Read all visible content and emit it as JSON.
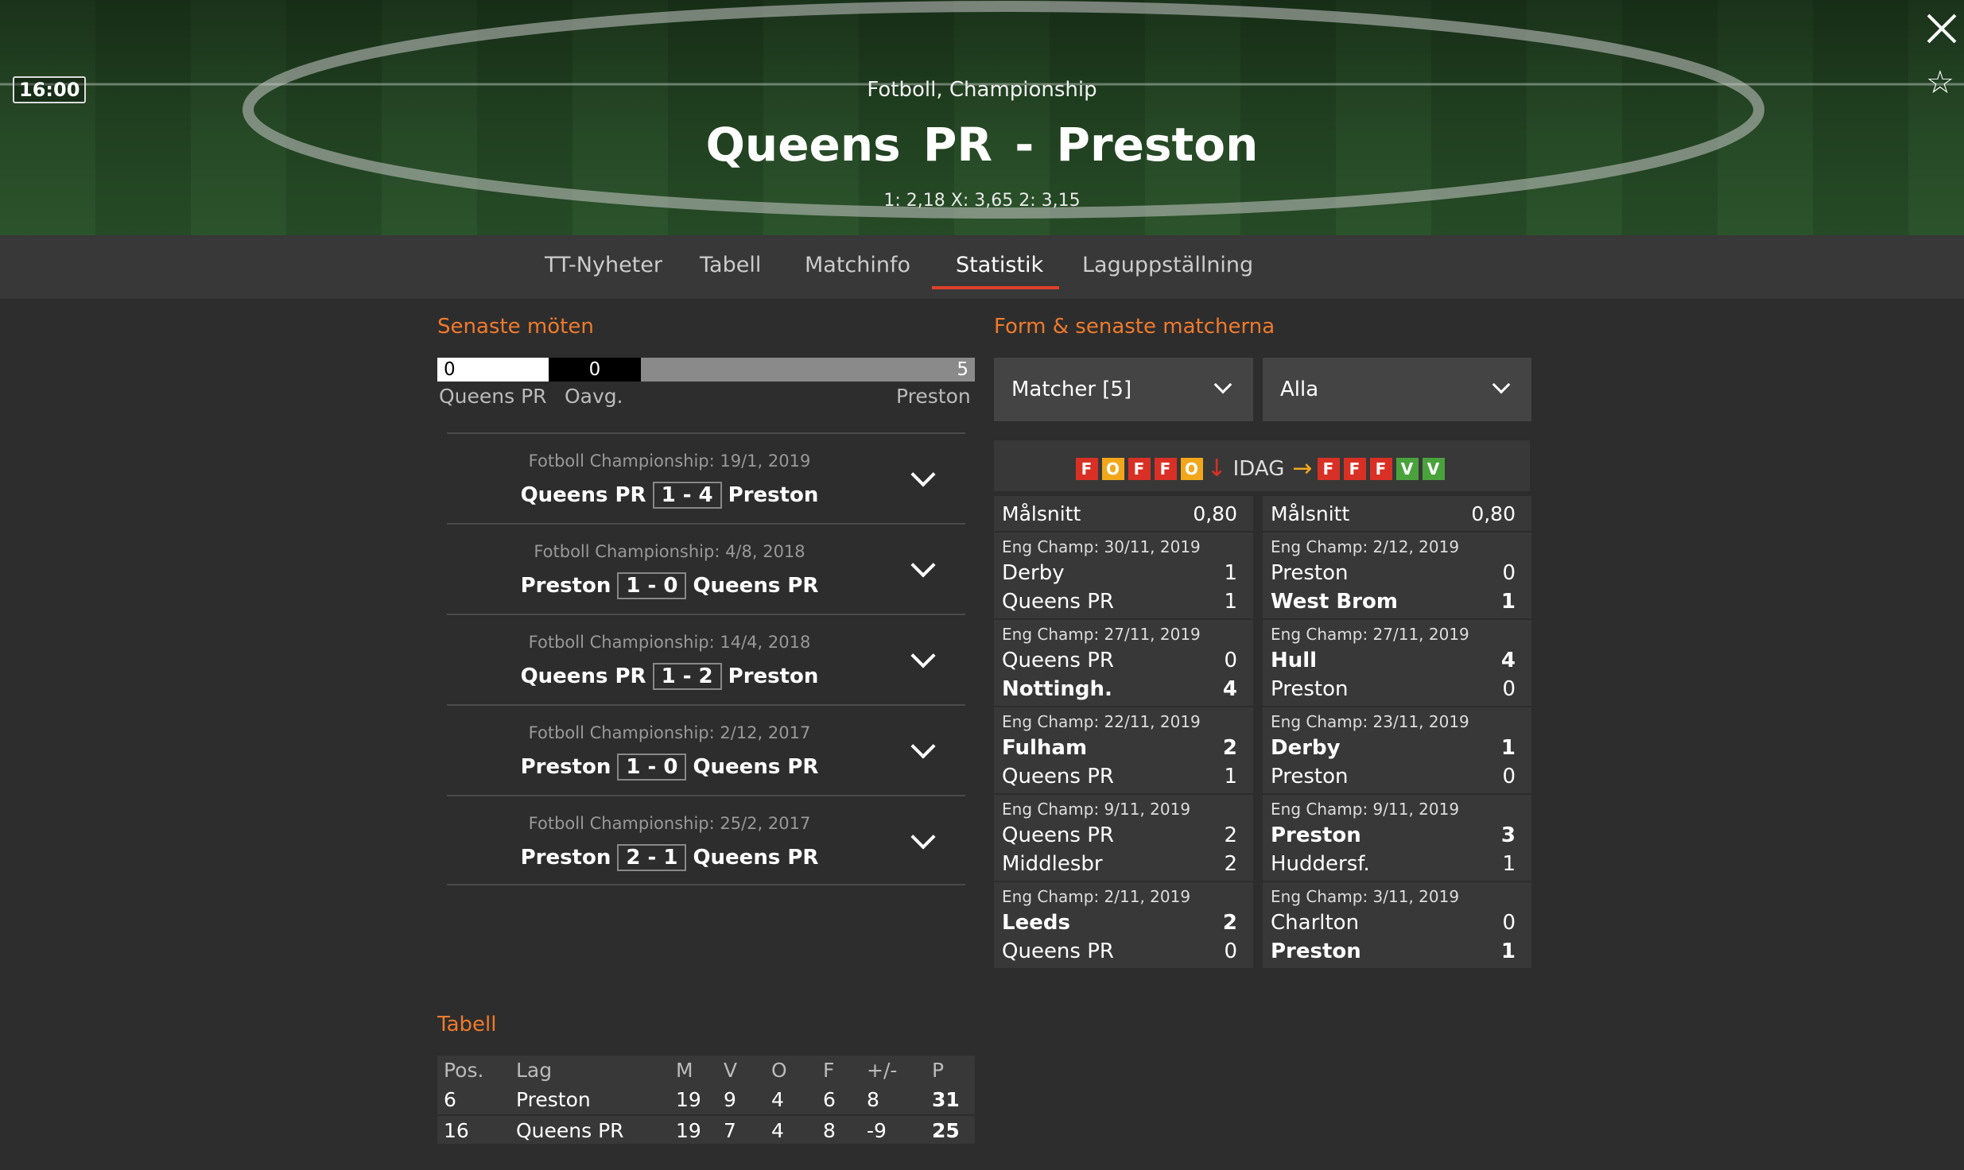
{
  "header": {
    "time": "16:00",
    "league": "Fotboll, Championship",
    "home": "Queens PR",
    "sep": "-",
    "away": "Preston",
    "odds": "1: 2,18 X: 3,65 2: 3,15"
  },
  "tabs": [
    "TT-Nyheter",
    "Tabell",
    "Matchinfo",
    "Statistik",
    "Laguppställning"
  ],
  "h2h": {
    "title": "Senaste möten",
    "bar": {
      "home": "0",
      "draw": "0",
      "away": "5"
    },
    "labels": {
      "home": "Queens PR",
      "draw": "Oavg.",
      "away": "Preston"
    },
    "matches": [
      {
        "league": "Fotboll Championship: 19/1, 2019",
        "home": "Queens PR",
        "score": "1 - 4",
        "away": "Preston"
      },
      {
        "league": "Fotboll Championship: 4/8, 2018",
        "home": "Preston",
        "score": "1 - 0",
        "away": "Queens PR"
      },
      {
        "league": "Fotboll Championship: 14/4, 2018",
        "home": "Queens PR",
        "score": "1 - 2",
        "away": "Preston"
      },
      {
        "league": "Fotboll Championship: 2/12, 2017",
        "home": "Preston",
        "score": "1 - 0",
        "away": "Queens PR"
      },
      {
        "league": "Fotboll Championship: 25/2, 2017",
        "home": "Preston",
        "score": "2 - 1",
        "away": "Queens PR"
      }
    ]
  },
  "form": {
    "title": "Form & senaste matcherna",
    "select1": "Matcher [5]",
    "select2": "Alla",
    "today": "IDAG",
    "home_form": [
      "F",
      "O",
      "F",
      "F",
      "O"
    ],
    "away_form": [
      "F",
      "F",
      "F",
      "V",
      "V"
    ],
    "avg_label": "Målsnitt",
    "home_avg": "0,80",
    "away_avg": "0,80",
    "home_matches": [
      {
        "l": "Eng Champ: 30/11, 2019",
        "t1": "Derby",
        "g1": "1",
        "t2": "Queens PR",
        "g2": "1",
        "w": 0
      },
      {
        "l": "Eng Champ: 27/11, 2019",
        "t1": "Queens PR",
        "g1": "0",
        "t2": "Nottingh.",
        "g2": "4",
        "w": 2
      },
      {
        "l": "Eng Champ: 22/11, 2019",
        "t1": "Fulham",
        "g1": "2",
        "t2": "Queens PR",
        "g2": "1",
        "w": 1
      },
      {
        "l": "Eng Champ: 9/11, 2019",
        "t1": "Queens PR",
        "g1": "2",
        "t2": "Middlesbr",
        "g2": "2",
        "w": 0
      },
      {
        "l": "Eng Champ: 2/11, 2019",
        "t1": "Leeds",
        "g1": "2",
        "t2": "Queens PR",
        "g2": "0",
        "w": 1
      }
    ],
    "away_matches": [
      {
        "l": "Eng Champ: 2/12, 2019",
        "t1": "Preston",
        "g1": "0",
        "t2": "West Brom",
        "g2": "1",
        "w": 2
      },
      {
        "l": "Eng Champ: 27/11, 2019",
        "t1": "Hull",
        "g1": "4",
        "t2": "Preston",
        "g2": "0",
        "w": 1
      },
      {
        "l": "Eng Champ: 23/11, 2019",
        "t1": "Derby",
        "g1": "1",
        "t2": "Preston",
        "g2": "0",
        "w": 1
      },
      {
        "l": "Eng Champ: 9/11, 2019",
        "t1": "Preston",
        "g1": "3",
        "t2": "Huddersf.",
        "g2": "1",
        "w": 1
      },
      {
        "l": "Eng Champ: 3/11, 2019",
        "t1": "Charlton",
        "g1": "0",
        "t2": "Preston",
        "g2": "1",
        "w": 2
      }
    ]
  },
  "table": {
    "title": "Tabell",
    "headers": [
      "Pos.",
      "Lag",
      "M",
      "V",
      "O",
      "F",
      "+/-",
      "P"
    ],
    "rows": [
      [
        "6",
        "Preston",
        "19",
        "9",
        "4",
        "6",
        "8",
        "31"
      ],
      [
        "16",
        "Queens PR",
        "19",
        "7",
        "4",
        "8",
        "-9",
        "25"
      ]
    ]
  }
}
